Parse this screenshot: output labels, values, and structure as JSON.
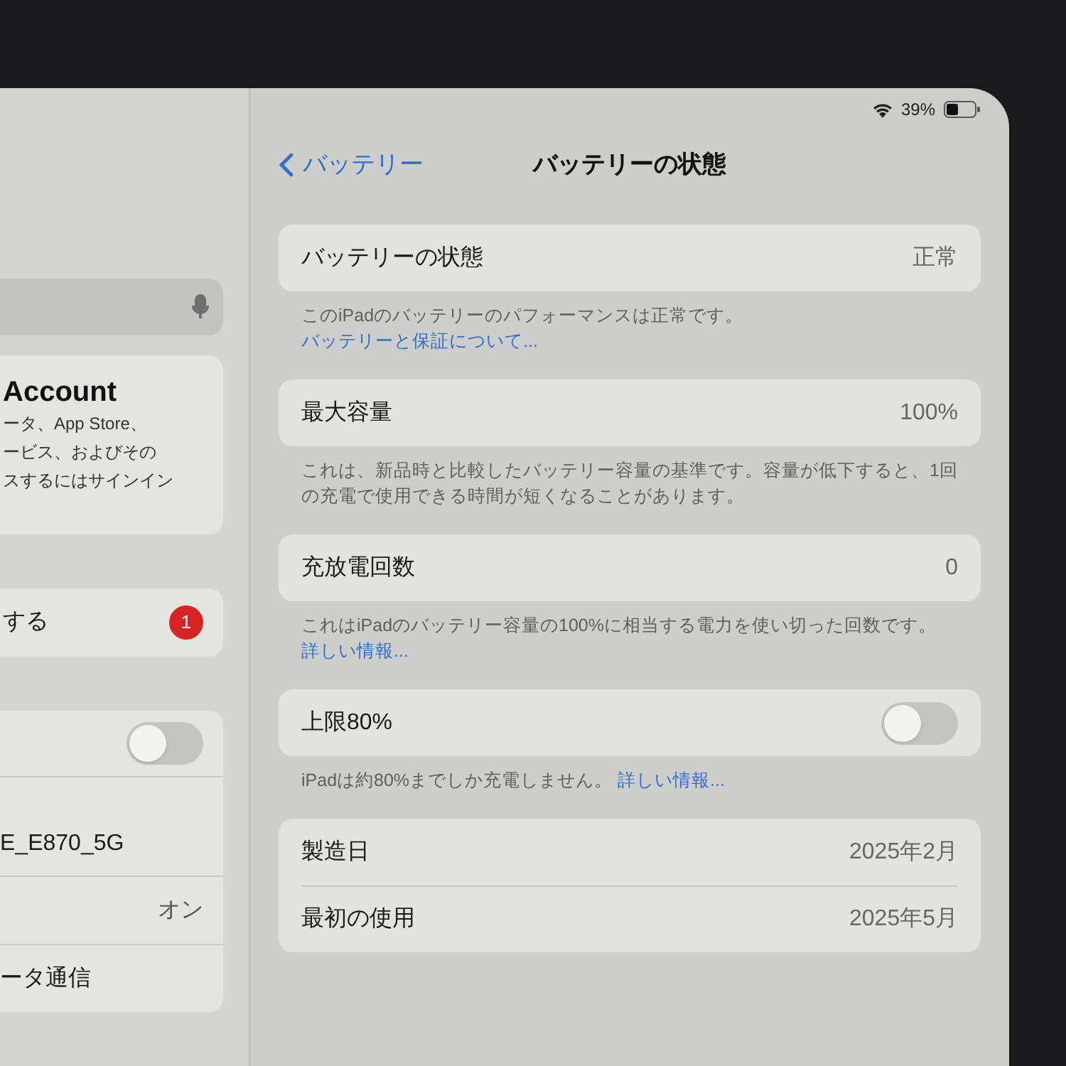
{
  "sidebar": {
    "account": {
      "title": "Account",
      "lines": [
        "ータ、App Store、",
        "ービス、およびその",
        "スするにはサインイン"
      ]
    },
    "sign_in": {
      "label": "する",
      "badge": "1"
    },
    "group": [
      {
        "kind": "toggle",
        "on": false
      },
      {
        "kind": "text",
        "label": "E_E870_5G"
      },
      {
        "kind": "value",
        "value": "オン"
      },
      {
        "kind": "text",
        "label": "ータ通信"
      }
    ]
  },
  "status_bar": {
    "battery": "39%"
  },
  "nav": {
    "back": "バッテリー",
    "title": "バッテリーの状態"
  },
  "sections": [
    {
      "rows": [
        {
          "kind": "value",
          "label": "バッテリーの状態",
          "value": "正常"
        }
      ],
      "footnote": "このiPadのバッテリーのパフォーマンスは正常です。",
      "link": "バッテリーと保証について..."
    },
    {
      "rows": [
        {
          "kind": "value",
          "label": "最大容量",
          "value": "100%"
        }
      ],
      "footnote": "これは、新品時と比較したバッテリー容量の基準です。容量が低下すると、1回の充電で使用できる時間が短くなることがあります。"
    },
    {
      "rows": [
        {
          "kind": "value",
          "label": "充放電回数",
          "value": "0"
        }
      ],
      "footnote": "これはiPadのバッテリー容量の100%に相当する電力を使い切った回数です。",
      "link": "詳しい情報..."
    },
    {
      "rows": [
        {
          "kind": "toggle",
          "label": "上限80%",
          "on": false
        }
      ],
      "footnote": "iPadは約80%までしか充電しません。",
      "link": "詳しい情報..."
    },
    {
      "rows": [
        {
          "kind": "value",
          "label": "製造日",
          "value": "2025年2月"
        },
        {
          "kind": "value",
          "label": "最初の使用",
          "value": "2025年5月"
        }
      ]
    }
  ]
}
